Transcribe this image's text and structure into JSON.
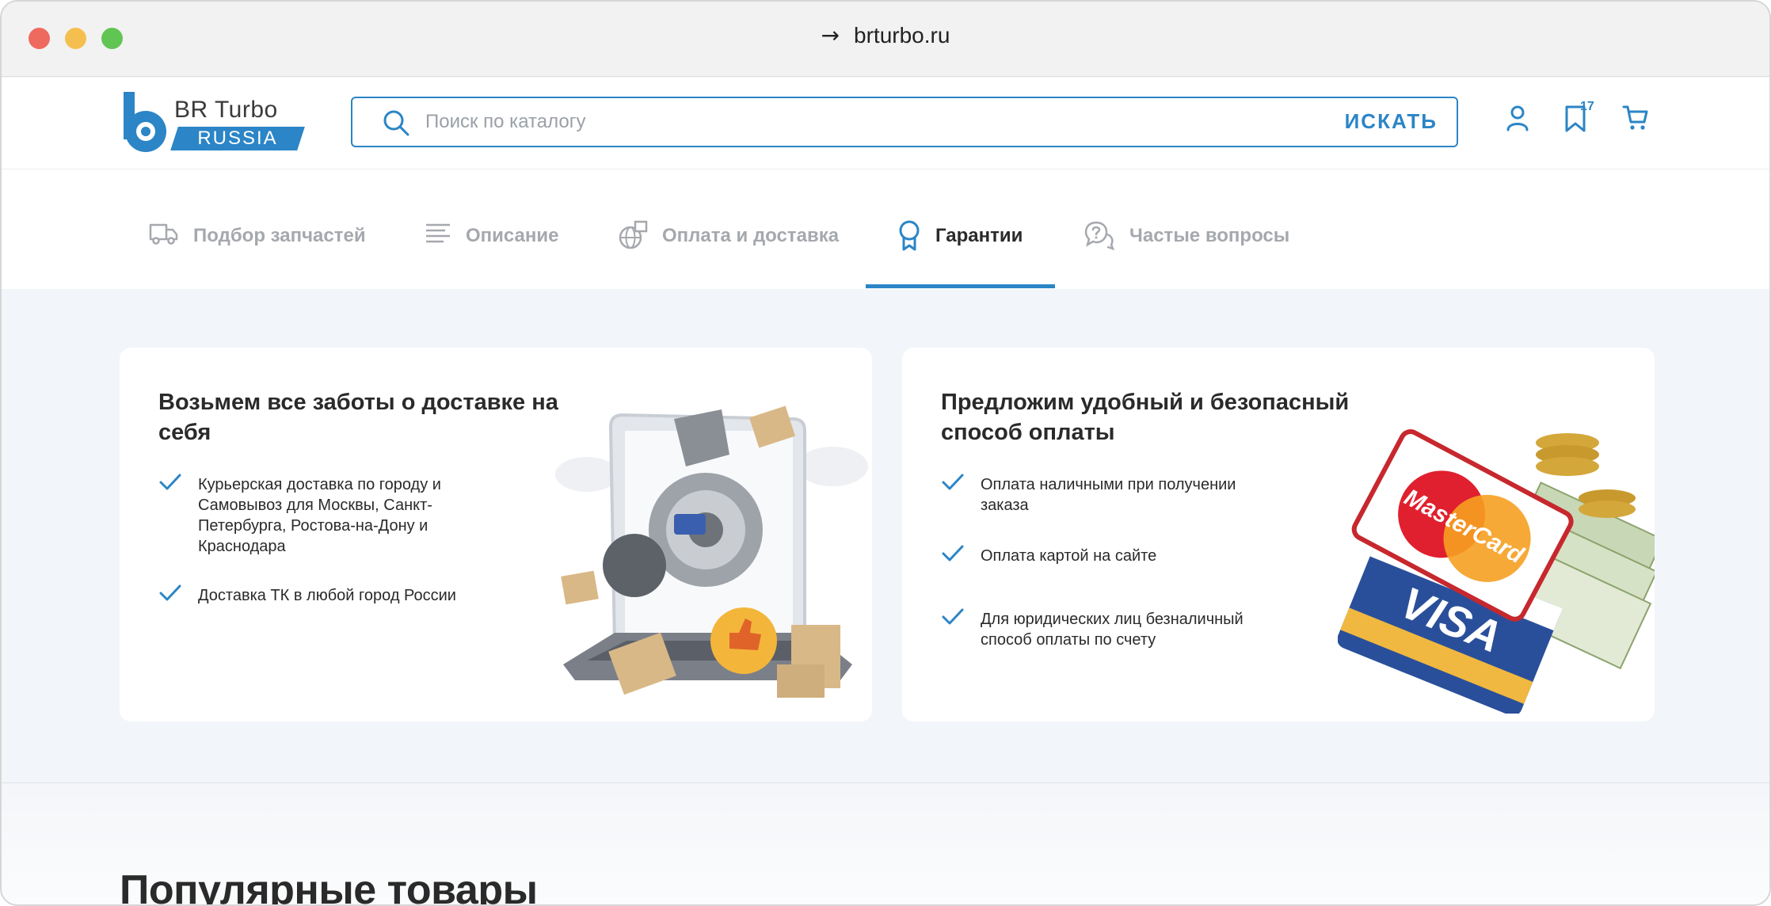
{
  "browser": {
    "url": "brturbo.ru",
    "nav_arrow": "→"
  },
  "header": {
    "logo_title": "BR Turbo",
    "logo_subtitle": "RUSSIA",
    "search_placeholder": "Поиск по каталогу",
    "search_button": "ИСКАТЬ",
    "bookmarks_count": "17"
  },
  "tabs": [
    {
      "label": "Подбор запчастей",
      "icon": "truck-icon",
      "active": false
    },
    {
      "label": "Описание",
      "icon": "lines-icon",
      "active": false
    },
    {
      "label": "Оплата и доставка",
      "icon": "globe-box-icon",
      "active": false
    },
    {
      "label": "Гарантии",
      "icon": "award-icon",
      "active": true
    },
    {
      "label": "Частые вопросы",
      "icon": "question-bubbles-icon",
      "active": false
    }
  ],
  "cards": [
    {
      "title": "Возьмем все заботы о доставке на себя",
      "items": [
        "Курьерская доставка по городу и Самовывоз для Москвы, Санкт-Петербурга, Ростова-на-Дону и Краснодара",
        "Доставка ТК в любой город России"
      ]
    },
    {
      "title": "Предложим удобный и безопасный способ оплаты",
      "items": [
        "Оплата наличными при получении заказа",
        "Оплата картой на сайте",
        "Для юридических лиц безналичный способ оплаты по счету"
      ],
      "card_brands": [
        "MasterCard",
        "VISA"
      ]
    }
  ],
  "popular": {
    "title": "Популярные товары"
  },
  "colors": {
    "accent": "#2b85c6",
    "background": "#f2f5f9",
    "muted_tab": "#a5a8ad"
  }
}
